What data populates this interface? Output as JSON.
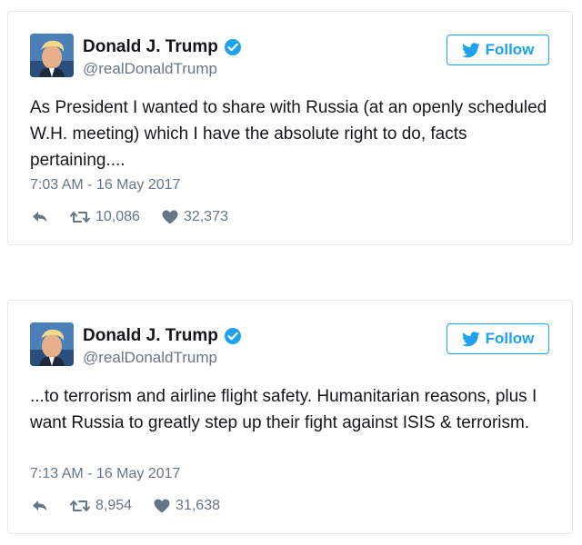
{
  "colors": {
    "accent": "#1da1f2",
    "text": "#14171a",
    "secondary": "#657786",
    "border": "#e1e8ed"
  },
  "icons": [
    "verified-badge-icon",
    "bird-icon",
    "reply-icon",
    "retweet-icon",
    "heart-icon"
  ],
  "tweets": [
    {
      "author": {
        "name": "Donald J. Trump",
        "handle": "@realDonaldTrump",
        "verified": true
      },
      "follow_label": "Follow",
      "text": "As President I wanted to share with Russia (at an openly scheduled W.H. meeting) which I have the absolute right to do, facts pertaining....",
      "timestamp": "7:03 AM - 16 May 2017",
      "retweets": "10,086",
      "likes": "32,373"
    },
    {
      "author": {
        "name": "Donald J. Trump",
        "handle": "@realDonaldTrump",
        "verified": true
      },
      "follow_label": "Follow",
      "text": "...to terrorism and airline flight safety. Humanitarian reasons, plus I want Russia to greatly step up their fight against ISIS & terrorism.",
      "timestamp": "7:13 AM - 16 May 2017",
      "retweets": "8,954",
      "likes": "31,638"
    }
  ]
}
